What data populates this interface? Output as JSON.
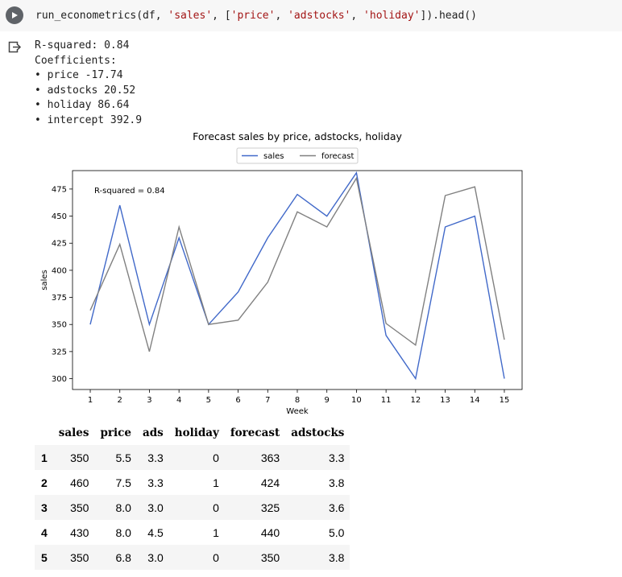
{
  "cell": {
    "code_func": "run_econometrics",
    "code_pre": "(df, ",
    "code_str1": "'sales'",
    "code_mid1": ", [",
    "code_str2": "'price'",
    "code_sep1": ", ",
    "code_str3": "'adstocks'",
    "code_sep2": ", ",
    "code_str4": "'holiday'",
    "code_post": "]).head()"
  },
  "output": {
    "lines": [
      "R-squared: 0.84",
      "Coefficients:",
      "• price -17.74",
      "• adstocks 20.52",
      "• holiday 86.64",
      "• intercept 392.9"
    ]
  },
  "chart_data": {
    "type": "line",
    "title": "Forecast sales by price, adstocks, holiday",
    "xlabel": "Week",
    "ylabel": "sales",
    "annotation": "R-squared = 0.84",
    "x": [
      1,
      2,
      3,
      4,
      5,
      6,
      7,
      8,
      9,
      10,
      11,
      12,
      13,
      14,
      15
    ],
    "xlim": [
      0.4,
      15.6
    ],
    "ylim": [
      290,
      492
    ],
    "yticks": [
      300,
      325,
      350,
      375,
      400,
      425,
      450,
      475
    ],
    "legend_position": "top-center",
    "grid": false,
    "series": [
      {
        "name": "sales",
        "color": "#4169c9",
        "values": [
          350,
          460,
          350,
          430,
          350,
          380,
          430,
          470,
          450,
          490,
          340,
          300,
          440,
          450,
          300
        ]
      },
      {
        "name": "forecast",
        "color": "#808080",
        "values": [
          363,
          424,
          325,
          440,
          350,
          354,
          389,
          454,
          440,
          485,
          351,
          331,
          469,
          477,
          336
        ]
      }
    ]
  },
  "table": {
    "columns": [
      "sales",
      "price",
      "ads",
      "holiday",
      "forecast",
      "adstocks"
    ],
    "rows": [
      {
        "index": "1",
        "cells": [
          "350",
          "5.5",
          "3.3",
          "0",
          "363",
          "3.3"
        ]
      },
      {
        "index": "2",
        "cells": [
          "460",
          "7.5",
          "3.3",
          "1",
          "424",
          "3.8"
        ]
      },
      {
        "index": "3",
        "cells": [
          "350",
          "8.0",
          "3.0",
          "0",
          "325",
          "3.6"
        ]
      },
      {
        "index": "4",
        "cells": [
          "430",
          "8.0",
          "4.5",
          "1",
          "440",
          "5.0"
        ]
      },
      {
        "index": "5",
        "cells": [
          "350",
          "6.8",
          "3.0",
          "0",
          "350",
          "3.8"
        ]
      }
    ]
  }
}
